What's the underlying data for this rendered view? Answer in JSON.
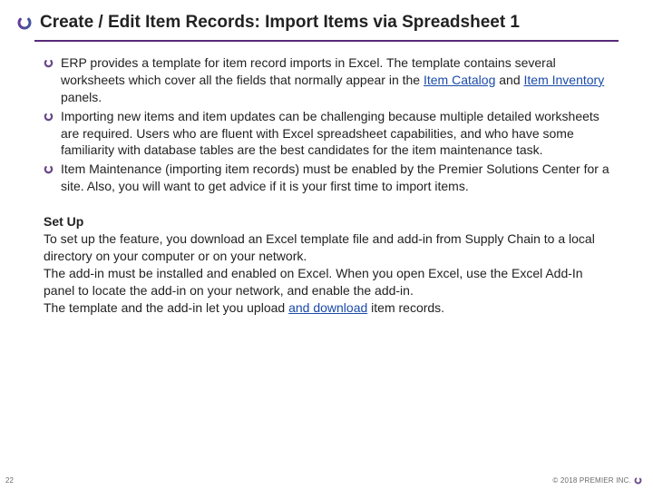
{
  "header": {
    "title": "Create / Edit Item Records: Import Items via Spreadsheet 1"
  },
  "bullets": [
    {
      "pre": "ERP provides a template for item record imports in Excel. The template contains several worksheets which cover all the fields that normally appear in the ",
      "link1": "Item Catalog",
      "mid": " and ",
      "link2": "Item Inventory",
      "post": " panels."
    },
    {
      "text": "Importing new items and item updates can be challenging because multiple detailed worksheets are required. Users who are fluent with Excel spreadsheet capabilities, and who have some familiarity with database tables are the best candidates for the item maintenance task."
    },
    {
      "text": "Item Maintenance (importing item records) must be enabled by the Premier Solutions Center for a site. Also, you will want to get advice if it is your first time to import items."
    }
  ],
  "setup": {
    "title": "Set Up",
    "p1": "To set up the feature, you download an Excel template file and add-in from Supply Chain to a local directory on your computer or on your network.",
    "p2": "The add-in must be installed and enabled on Excel. When you open Excel, use the Excel Add-In panel to locate the add-in on your network, and enable the add-in.",
    "p3_pre": "The template and the add-in let you upload ",
    "p3_link": "and download",
    "p3_post": " item records."
  },
  "footer": {
    "page": "22",
    "copyright": "© 2018 PREMIER INC."
  }
}
